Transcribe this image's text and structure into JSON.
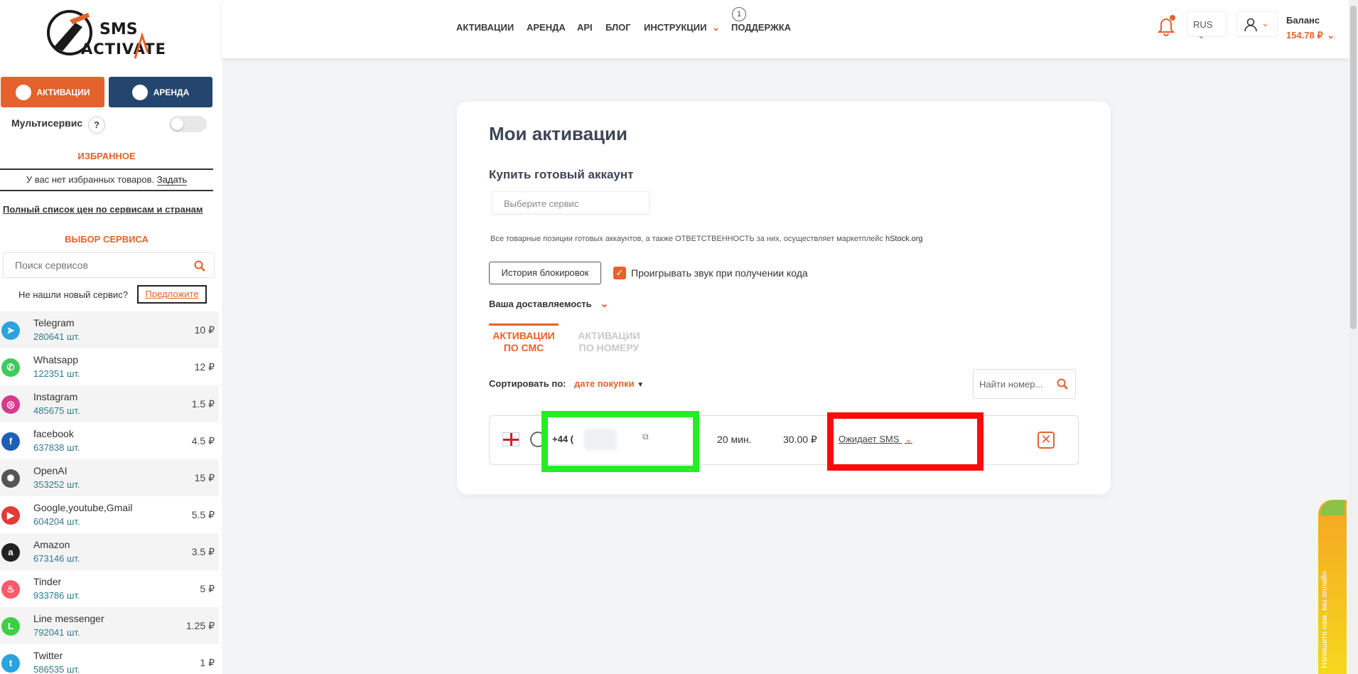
{
  "logo": {
    "line1": "SMS",
    "line2": "ACTIVATE"
  },
  "sidebar": {
    "tab_activations": "АКТИВАЦИИ",
    "tab_rent": "АРЕНДА",
    "multiservice": "Мультисервис",
    "help": "?",
    "favorites_title": "ИЗБРАННОЕ",
    "favorites_empty": "У вас нет избранных товаров.",
    "favorites_set": "Задать",
    "full_price_list": "Полный список цен по сервисам и странам",
    "service_choice_title": "ВЫБОР СЕРВИСА",
    "search_placeholder": "Поиск сервисов",
    "not_found": "Не нашли новый сервис?",
    "suggest": "Предложите",
    "services": [
      {
        "name": "Telegram",
        "count": "280641 шт.",
        "price": "10 ₽",
        "color": "#2aa3de",
        "glyph": "➤"
      },
      {
        "name": "Whatsapp",
        "count": "122351 шт.",
        "price": "12 ₽",
        "color": "#3ecb5b",
        "glyph": "✆"
      },
      {
        "name": "Instagram",
        "count": "485675 шт.",
        "price": "1.5 ₽",
        "color": "#d63a8f",
        "glyph": "◎"
      },
      {
        "name": "facebook",
        "count": "637838 шт.",
        "price": "4.5 ₽",
        "color": "#1d5fb5",
        "glyph": "f"
      },
      {
        "name": "OpenAI",
        "count": "353252 шт.",
        "price": "15 ₽",
        "color": "#555555",
        "glyph": "✺"
      },
      {
        "name": "Google,youtube,Gmail",
        "count": "604204 шт.",
        "price": "5.5 ₽",
        "color": "#e03b34",
        "glyph": "▶"
      },
      {
        "name": "Amazon",
        "count": "673146 шт.",
        "price": "3.5 ₽",
        "color": "#222222",
        "glyph": "a"
      },
      {
        "name": "Tinder",
        "count": "933786 шт.",
        "price": "5 ₽",
        "color": "#fb5a6a",
        "glyph": "♨"
      },
      {
        "name": "Line messenger",
        "count": "792041 шт.",
        "price": "1.25 ₽",
        "color": "#3fcf43",
        "glyph": "L"
      },
      {
        "name": "Twitter",
        "count": "586535 шт.",
        "price": "1 ₽",
        "color": "#2aa3de",
        "glyph": "t"
      }
    ]
  },
  "header": {
    "nav": [
      "АКТИВАЦИИ",
      "АРЕНДА",
      "API",
      "БЛОГ",
      "ИНСТРУКЦИИ",
      "ПОДДЕРЖКА"
    ],
    "activations_badge": "1",
    "language": "RUS",
    "balance_label": "Баланс",
    "balance_value": "154.78 ₽"
  },
  "main": {
    "title": "Мои активации",
    "buy_account": "Купить готовый аккаунт",
    "select_placeholder": "Выберите сервис",
    "note": "Все товарные позиции готовых аккаунтов, а также ОТВЕТСТВЕННОСТЬ за них, осуществляет маркетплейс",
    "note_link": "hStock.org",
    "block_history": "История блокировок",
    "play_sound": "Проигрывать звук при получении кода",
    "deliverability": "Ваша доставляемость",
    "tab_sms_line1": "АКТИВАЦИИ",
    "tab_sms_line2": "ПО СМС",
    "tab_number_line1": "АКТИВАЦИИ",
    "tab_number_line2": "ПО НОМЕРУ",
    "sort_label": "Сортировать по:",
    "sort_value": "дате покупки",
    "find_placeholder": "Найти номер...",
    "activation": {
      "phone": "+44 (",
      "time": "20 мин.",
      "price": "30.00 ₽",
      "status": "Ожидает SMS"
    }
  },
  "widget": {
    "text": "Напишите нам, мы онлайн"
  },
  "colors": {
    "accent": "#e4622b",
    "rent": "#24456e",
    "highlight_green": "#22ee22",
    "highlight_red": "#ff0a0a"
  }
}
